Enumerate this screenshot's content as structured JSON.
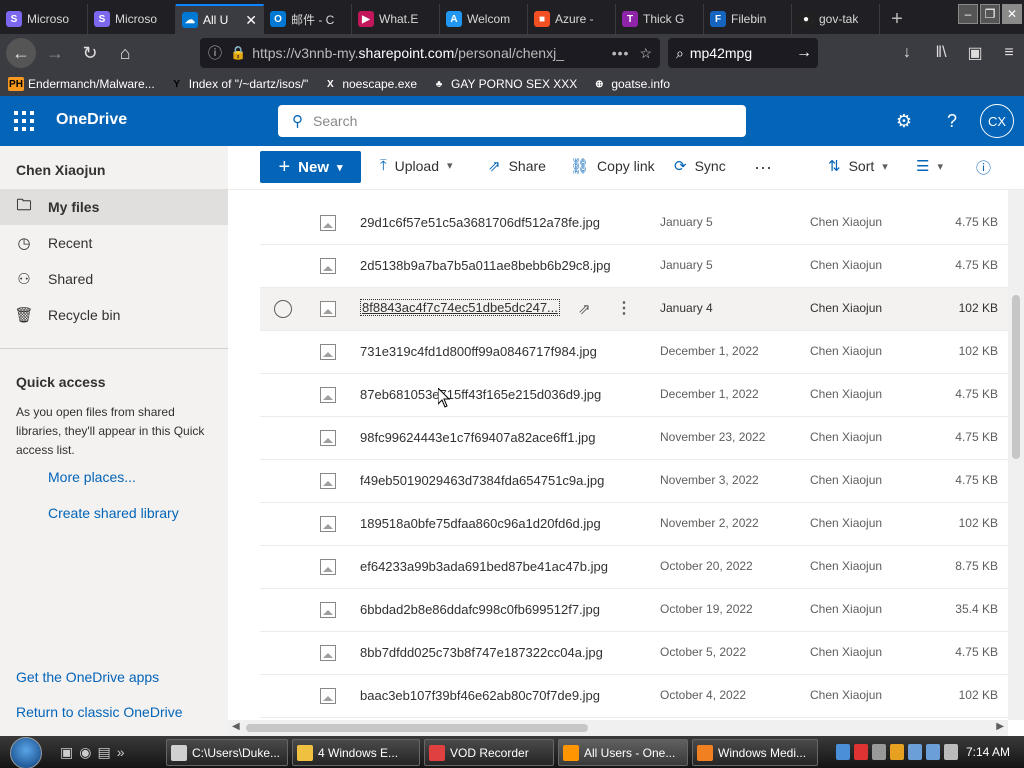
{
  "browser": {
    "tabs": [
      {
        "label": "Microso",
        "icon_color": "#7b68ee",
        "icon": "S"
      },
      {
        "label": "Microso",
        "icon_color": "#7b68ee",
        "icon": "S"
      },
      {
        "label": "All U",
        "icon_color": "#0078d4",
        "icon": "☁",
        "active": true
      },
      {
        "label": "邮件 - C",
        "icon_color": "#0078d4",
        "icon": "O"
      },
      {
        "label": "What.E",
        "icon_color": "#c2185b",
        "icon": "▶"
      },
      {
        "label": "Welcom",
        "icon_color": "#2196f3",
        "icon": "A"
      },
      {
        "label": "Azure -",
        "icon_color": "#f25022",
        "icon": "■"
      },
      {
        "label": "Thick G",
        "icon_color": "#8e24aa",
        "icon": "T"
      },
      {
        "label": "Filebin",
        "icon_color": "#1565c0",
        "icon": "F"
      },
      {
        "label": "gov-tak",
        "icon_color": "#212121",
        "icon": "●"
      }
    ],
    "new_tab": "+",
    "url_prefix": "https://v3nnb-my.",
    "url_domain": "sharepoint.com",
    "url_suffix": "/personal/chenxj_",
    "url_more": "•••",
    "search_value": "mp42mpg",
    "bookmarks": [
      {
        "label": "Endermanch/Malware...",
        "icon": "PH",
        "icon_color": "#f7971d"
      },
      {
        "label": "Index of \"/~dartz/isos/\"",
        "icon": "Y",
        "icon_color": "#000000"
      },
      {
        "label": "noescape.exe",
        "icon": "X",
        "icon_color": "#ffffff"
      },
      {
        "label": "GAY PORNO SEX XXX",
        "icon": "♣",
        "icon_color": "#ffffff"
      },
      {
        "label": "goatse.info",
        "icon": "⊕",
        "icon_color": "#ffffff"
      }
    ]
  },
  "onedrive": {
    "title": "OneDrive",
    "search_placeholder": "Search",
    "avatar_initials": "CX",
    "user_name": "Chen Xiaojun",
    "nav": [
      {
        "label": "My files",
        "icon": "folder-icon",
        "selected": true
      },
      {
        "label": "Recent",
        "icon": "clock-icon"
      },
      {
        "label": "Shared",
        "icon": "people-icon"
      },
      {
        "label": "Recycle bin",
        "icon": "trash-icon"
      }
    ],
    "quick_access_title": "Quick access",
    "quick_access_desc": "As you open files from shared libraries, they'll appear in this Quick access list.",
    "more_places": "More places...",
    "create_library": "Create shared library",
    "get_apps": "Get the OneDrive apps",
    "return_classic": "Return to classic OneDrive",
    "commands": {
      "new": "New",
      "upload": "Upload",
      "share": "Share",
      "copy_link": "Copy link",
      "sync": "Sync",
      "more": "···",
      "sort": "Sort"
    },
    "files": [
      {
        "name": "29d1c6f57e51c5a3681706df512a78fe.jpg",
        "date": "January 5",
        "modified_by": "Chen Xiaojun",
        "size": "4.75 KB"
      },
      {
        "name": "2d5138b9a7ba7b5a011ae8bebb6b29c8.jpg",
        "date": "January 5",
        "modified_by": "Chen Xiaojun",
        "size": "4.75 KB"
      },
      {
        "name": "8f8843ac4f7c74ec51dbe5dc247...",
        "date": "January 4",
        "modified_by": "Chen Xiaojun",
        "size": "102 KB",
        "hover": true
      },
      {
        "name": "731e319c4fd1d800ff99a0846717f984.jpg",
        "date": "December 1, 2022",
        "modified_by": "Chen Xiaojun",
        "size": "102 KB"
      },
      {
        "name": "87eb681053e715ff43f165e215d036d9.jpg",
        "date": "December 1, 2022",
        "modified_by": "Chen Xiaojun",
        "size": "4.75 KB"
      },
      {
        "name": "98fc99624443e1c7f69407a82ace6ff1.jpg",
        "date": "November 23, 2022",
        "modified_by": "Chen Xiaojun",
        "size": "4.75 KB"
      },
      {
        "name": "f49eb5019029463d7384fda654751c9a.jpg",
        "date": "November 3, 2022",
        "modified_by": "Chen Xiaojun",
        "size": "4.75 KB"
      },
      {
        "name": "189518a0bfe75dfaa860c96a1d20fd6d.jpg",
        "date": "November 2, 2022",
        "modified_by": "Chen Xiaojun",
        "size": "102 KB"
      },
      {
        "name": "ef64233a99b3ada691bed87be41ac47b.jpg",
        "date": "October 20, 2022",
        "modified_by": "Chen Xiaojun",
        "size": "8.75 KB"
      },
      {
        "name": "6bbdad2b8e86ddafc998c0fb699512f7.jpg",
        "date": "October 19, 2022",
        "modified_by": "Chen Xiaojun",
        "size": "35.4 KB"
      },
      {
        "name": "8bb7dfdd025c73b8f747e187322cc04a.jpg",
        "date": "October 5, 2022",
        "modified_by": "Chen Xiaojun",
        "size": "4.75 KB"
      },
      {
        "name": "baac3eb107f39bf46e62ab80c70f7de9.jpg",
        "date": "October 4, 2022",
        "modified_by": "Chen Xiaojun",
        "size": "102 KB"
      }
    ]
  },
  "taskbar": {
    "tasks": [
      {
        "label": "C:\\Users\\Duke...",
        "icon_color": "#d0d0d0"
      },
      {
        "label": "4 Windows E...",
        "icon_color": "#f0c040"
      },
      {
        "label": "VOD Recorder",
        "icon_color": "#e04040"
      },
      {
        "label": "All Users - One...",
        "icon_color": "#ff9500",
        "active": true
      },
      {
        "label": "Windows Medi...",
        "icon_color": "#f08020"
      }
    ],
    "clock": "7:14 AM"
  }
}
